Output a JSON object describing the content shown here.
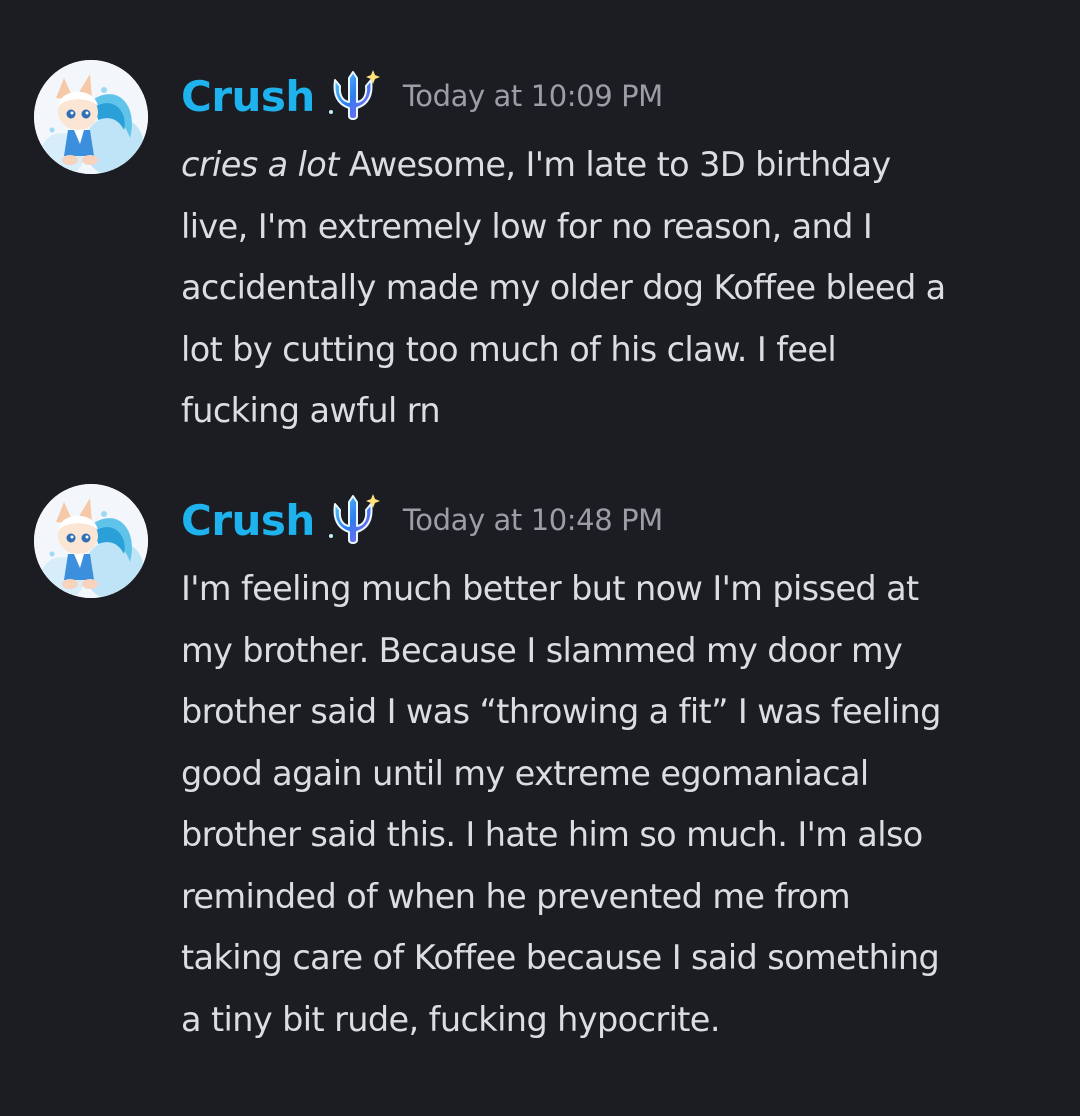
{
  "messages": [
    {
      "author": "Crush",
      "role_icon": "trident-icon",
      "timestamp": "Today at 10:09 PM",
      "emphasis": "cries a lot",
      "lines": [
        " Awesome, I'm late to 3D birthday",
        "live, I'm extremely low for no reason, and I",
        "accidentally made my older dog Koffee bleed a",
        "lot by cutting too much of his claw. I feel",
        "fucking awful rn"
      ]
    },
    {
      "author": "Crush",
      "role_icon": "trident-icon",
      "timestamp": "Today at 10:48 PM",
      "lines": [
        "I'm feeling much better but now I'm pissed at",
        "my brother. Because I slammed my door my",
        "brother said I was “throwing a fit” I was feeling",
        "good again until my extreme egomaniacal",
        "brother said this. I hate him so much. I'm also",
        "reminded of when he prevented me from",
        "taking care of Koffee because I said something",
        "a tiny bit rude, fucking hypocrite."
      ]
    }
  ],
  "colors": {
    "background": "#1c1d22",
    "username": "#1eb3ef",
    "timestamp": "#9c9ea6",
    "text": "#dcdde1"
  }
}
